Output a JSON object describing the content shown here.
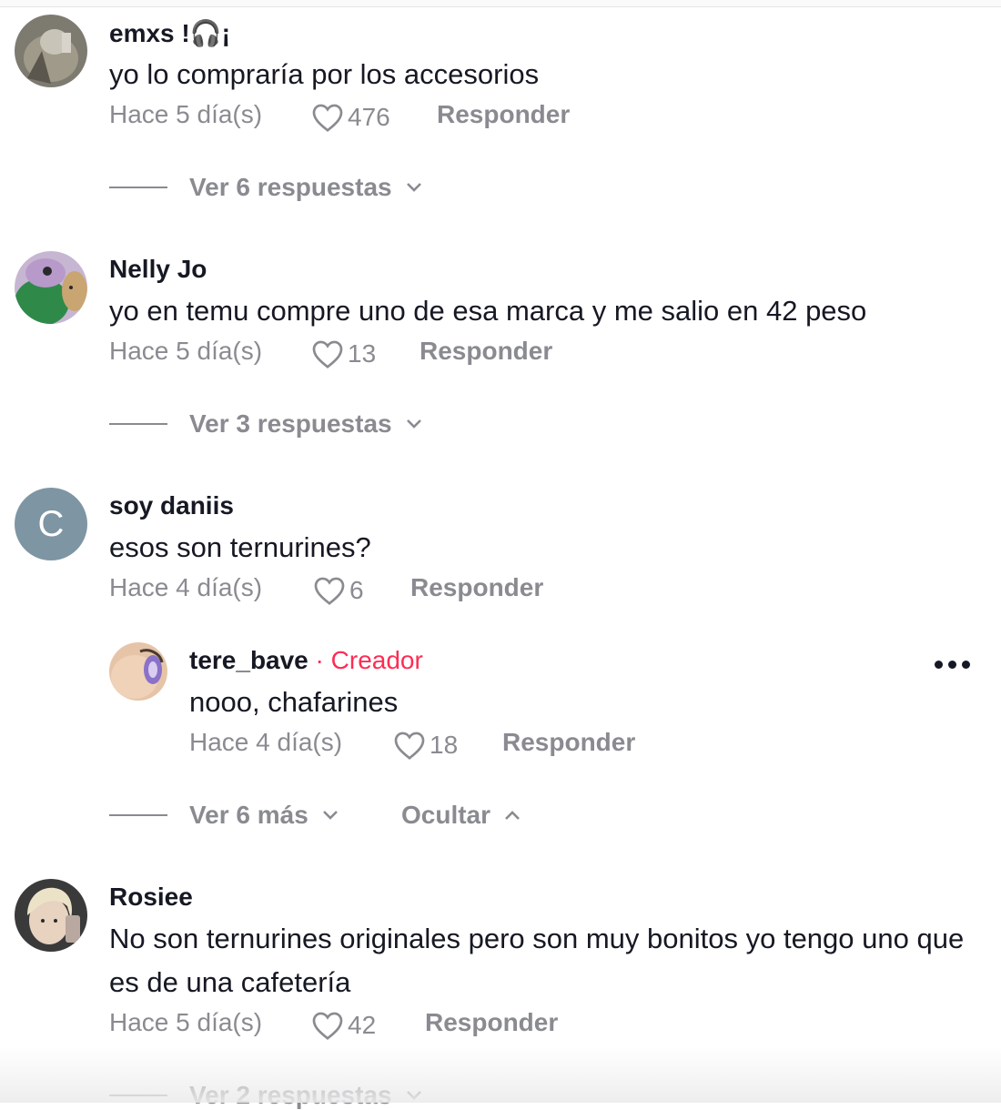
{
  "comments": [
    {
      "username": "emxs !🎧¡",
      "text": "yo lo compraría por los accesorios",
      "time": "Hace 5 día(s)",
      "likes": "476",
      "reply_label": "Responder",
      "view_replies": "Ver 6 respuestas"
    },
    {
      "username": "Nelly Jo",
      "text": "yo en temu compre uno de esa marca y me salio en 42 peso",
      "time": "Hace 5 día(s)",
      "likes": "13",
      "reply_label": "Responder",
      "view_replies": "Ver 3 respuestas"
    },
    {
      "username": "soy daniis",
      "avatar_letter": "C",
      "text": "esos son ternurines?",
      "time": "Hace 4 día(s)",
      "likes": "6",
      "reply_label": "Responder",
      "reply": {
        "username": "tere_bave",
        "badge": " · Creador",
        "text": "nooo, chafarines",
        "time": "Hace 4 día(s)",
        "likes": "18",
        "reply_label": "Responder"
      },
      "view_more": "Ver 6 más",
      "hide_label": "Ocultar"
    },
    {
      "username": "Rosiee",
      "text": "No son ternurines originales pero son muy bonitos yo tengo uno que es de una cafetería",
      "time": "Hace 5 día(s)",
      "likes": "42",
      "reply_label": "Responder",
      "view_replies": "Ver 2 respuestas"
    }
  ],
  "colors": {
    "text": "#161823",
    "secondary": "#8a8b91",
    "creator": "#fe2c55",
    "letter_avatar": "#7e95a3"
  }
}
